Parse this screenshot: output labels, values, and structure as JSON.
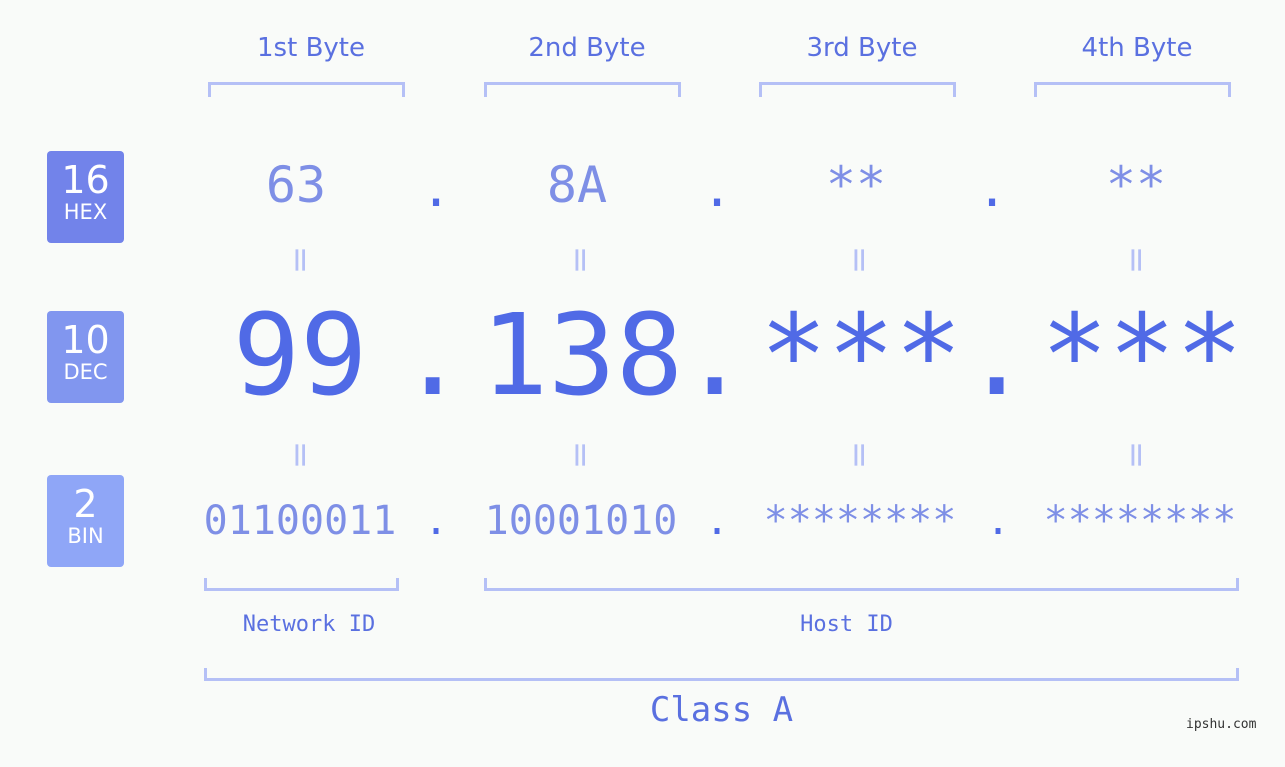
{
  "bytes": {
    "headers": [
      "1st Byte",
      "2nd Byte",
      "3rd Byte",
      "4th Byte"
    ]
  },
  "rows": {
    "hex": {
      "base": "16",
      "label": "HEX",
      "values": [
        "63",
        "8A",
        "**",
        "**"
      ],
      "badge_color": "#7283ea"
    },
    "dec": {
      "base": "10",
      "label": "DEC",
      "values": [
        "99",
        "138",
        "***",
        "***"
      ],
      "badge_color": "#8196ef"
    },
    "bin": {
      "base": "2",
      "label": "BIN",
      "values": [
        "01100011",
        "10001010",
        "********",
        "********"
      ],
      "badge_color": "#8fa6f7"
    }
  },
  "separator": ".",
  "equals": "=",
  "segments": {
    "network": "Network ID",
    "host": "Host ID",
    "class": "Class A"
  },
  "watermark": "ipshu.com",
  "colors": {
    "accent": "#506ae6",
    "light": "#7e8fe6",
    "bracket": "#b5c0f6",
    "background": "#f9fbf9"
  }
}
